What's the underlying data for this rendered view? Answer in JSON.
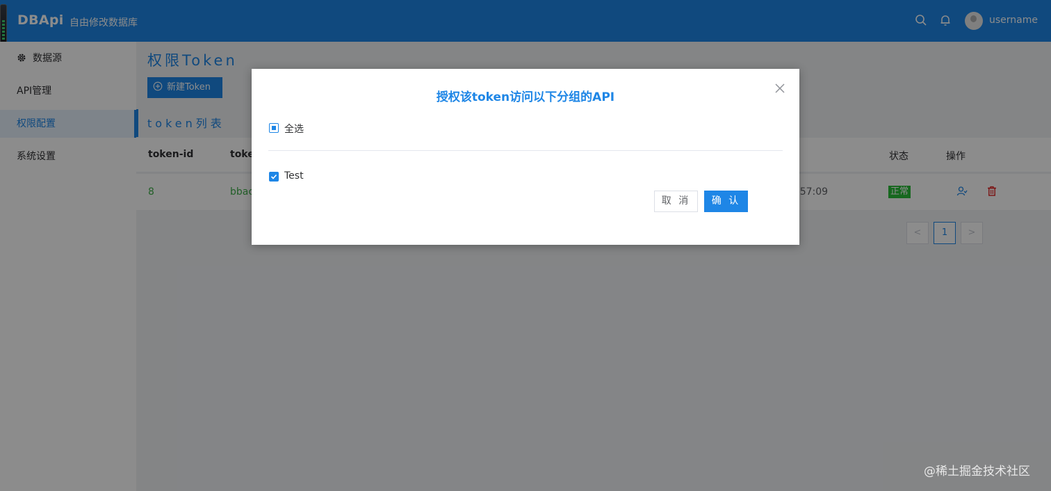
{
  "header": {
    "brand": "DBApi",
    "subtitle": "自由修改数据库",
    "username": "username",
    "icons": [
      "search-icon",
      "bell-icon",
      "avatar"
    ]
  },
  "sidebar": {
    "items": [
      {
        "label": "数据源",
        "icon": "gear-icon"
      },
      {
        "label": "API管理"
      },
      {
        "label": "权限配置",
        "active": true
      },
      {
        "label": "系统设置"
      }
    ]
  },
  "main": {
    "page_title": "权限Token",
    "new_button_label": "新建Token",
    "section_title": "token列表",
    "table": {
      "headers": [
        "token-id",
        "toke",
        "状态",
        "操作"
      ],
      "rows": [
        {
          "id": "8",
          "token": "bbac",
          "time": ":57:09",
          "status": "正常"
        }
      ]
    },
    "pagination": {
      "prev": "<",
      "current": "1",
      "next": ">"
    }
  },
  "dialog": {
    "title": "授权该token访问以下分组的API",
    "select_all_label": "全选",
    "groups": [
      {
        "label": "Test",
        "checked": true
      }
    ],
    "cancel_label": "取 消",
    "confirm_label": "确 认"
  },
  "watermark": "@稀土掘金技术社区",
  "colors": {
    "primary": "#1e86e6",
    "success": "#2bbd3a",
    "danger": "#e02020"
  }
}
